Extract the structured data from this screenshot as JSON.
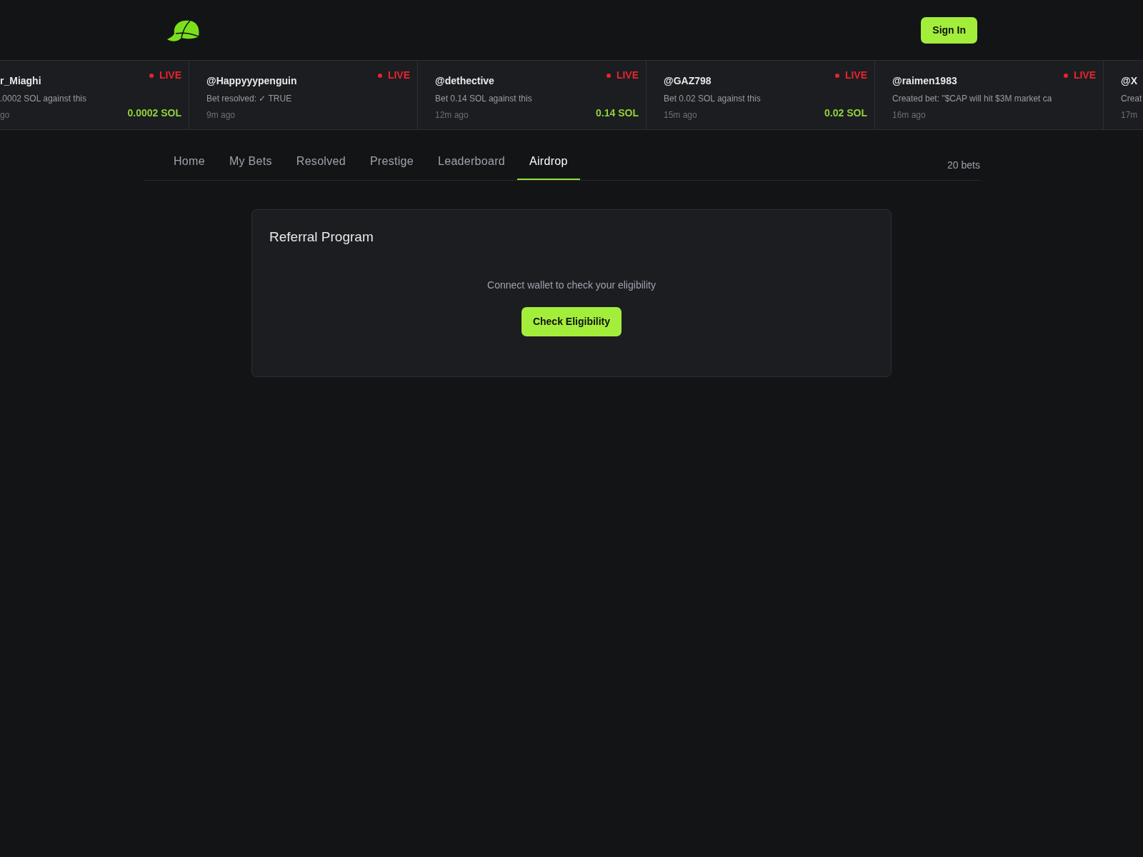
{
  "header": {
    "sign_in": "Sign In"
  },
  "ticker": [
    {
      "user": "r_Miaghi",
      "live": "LIVE",
      "text": ".0002 SOL against this",
      "time": "go",
      "amount": "0.0002 SOL",
      "kind": "cut-left"
    },
    {
      "user": "@Happyyypenguin",
      "live": "LIVE",
      "text": "Bet resolved: ✓ TRUE",
      "time": "9m ago",
      "kind": "full"
    },
    {
      "user": "@dethective",
      "live": "LIVE",
      "text": "Bet 0.14 SOL against this",
      "time": "12m ago",
      "amount": "0.14 SOL",
      "kind": "full"
    },
    {
      "user": "@GAZ798",
      "live": "LIVE",
      "text": "Bet 0.02 SOL against this",
      "time": "15m ago",
      "amount": "0.02 SOL",
      "kind": "full"
    },
    {
      "user": "@raimen1983",
      "live": "LIVE",
      "text": "Created bet: \"$CAP will hit $3M market ca",
      "time": "16m ago",
      "kind": "full"
    },
    {
      "user": "@X",
      "text": "Creat",
      "time": "17m",
      "kind": "cut-right"
    }
  ],
  "tabs": [
    {
      "label": "Home",
      "selected": false
    },
    {
      "label": "My Bets",
      "selected": false
    },
    {
      "label": "Resolved",
      "selected": false
    },
    {
      "label": "Prestige",
      "selected": false
    },
    {
      "label": "Leaderboard",
      "selected": false
    },
    {
      "label": "Airdrop",
      "selected": true
    }
  ],
  "bet_count": "20 bets",
  "panel": {
    "title": "Referral Program",
    "message": "Connect wallet to check your eligibility",
    "button": "Check Eligibility"
  }
}
